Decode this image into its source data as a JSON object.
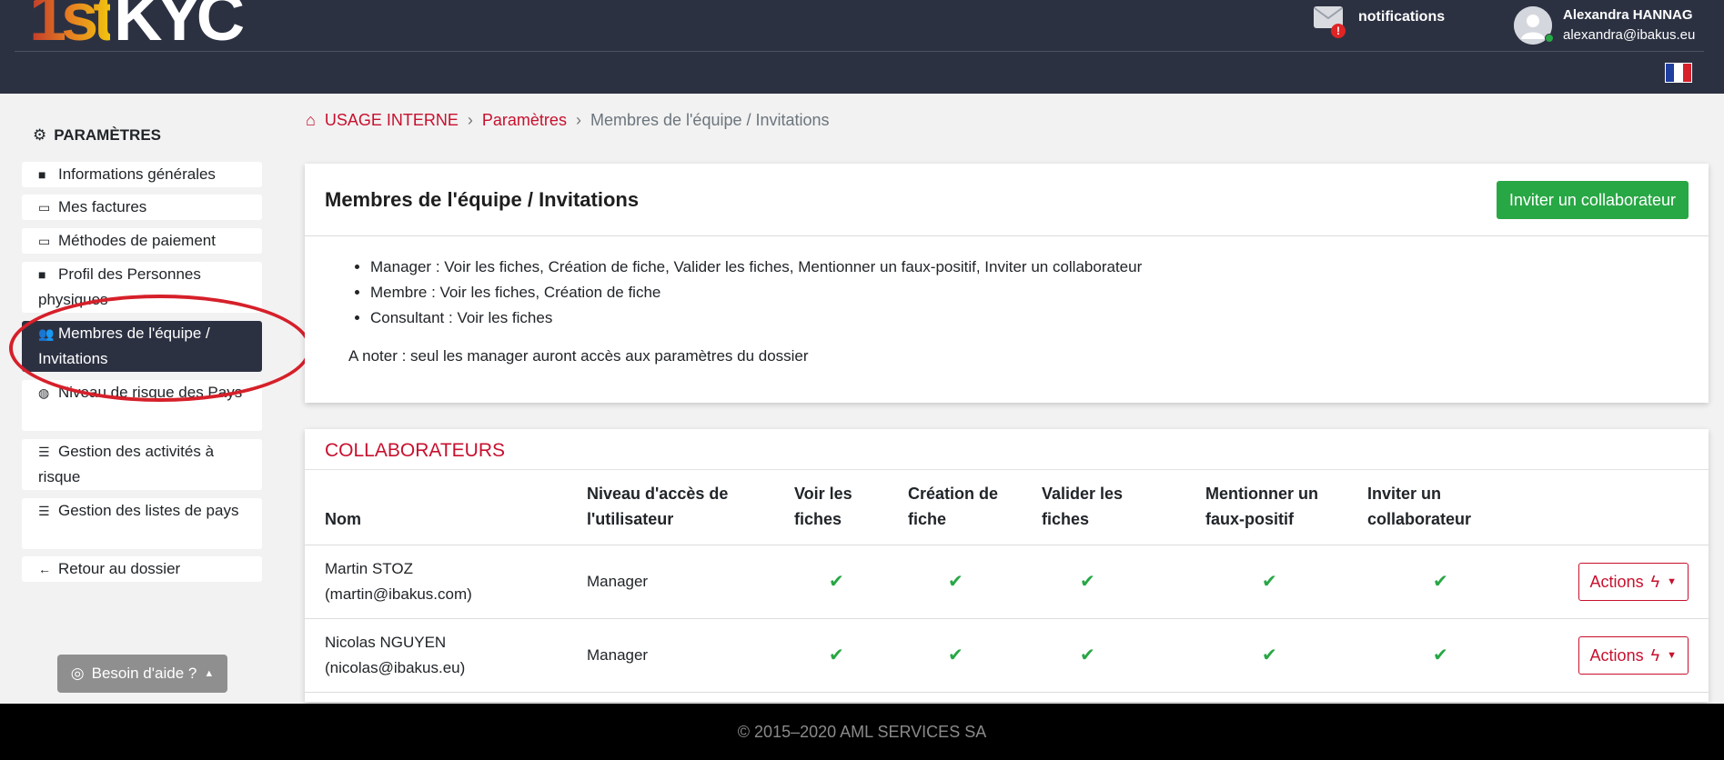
{
  "header": {
    "logo_a": "1st",
    "logo_b": "KYC",
    "notifications_label": "notifications",
    "notification_badge": "!",
    "user_name": "Alexandra HANNAG",
    "user_email": "alexandra@ibakus.eu"
  },
  "sidebar": {
    "title": "PARAMÈTRES",
    "items": [
      {
        "label": "Informations générales",
        "icon": "folder-icon"
      },
      {
        "label": "Mes factures",
        "icon": "credit-card-icon"
      },
      {
        "label": "Méthodes de paiement",
        "icon": "credit-card-icon"
      },
      {
        "label": "Profil des Personnes physiques",
        "icon": "folder-icon"
      },
      {
        "label": "Membres de l'équipe / Invitations",
        "icon": "users-icon",
        "active": true
      },
      {
        "label": "Niveau de risque des Pays",
        "icon": "globe-icon"
      },
      {
        "label": "Gestion des activités à risque",
        "icon": "list-icon"
      },
      {
        "label": "Gestion des listes de pays",
        "icon": "list-icon"
      },
      {
        "label": "Retour au dossier",
        "icon": "arrow-left-icon"
      }
    ],
    "help_label": "Besoin d'aide ?"
  },
  "breadcrumb": {
    "home": "USAGE INTERNE",
    "level2": "Paramètres",
    "current": "Membres de l'équipe / Invitations"
  },
  "panel": {
    "title": "Membres de l'équipe / Invitations",
    "invite_button": "Inviter un collaborateur",
    "permissions": [
      "Manager : Voir les fiches, Création de fiche, Valider les fiches, Mentionner un faux-positif, Inviter un collaborateur",
      "Membre : Voir les fiches, Création de fiche",
      "Consultant : Voir les fiches"
    ],
    "note": "A noter : seul les manager auront accès aux paramètres du dossier"
  },
  "collaborators": {
    "title": "COLLABORATEURS",
    "columns": [
      "Nom",
      "Niveau d'accès de l'utilisateur",
      "Voir les fiches",
      "Création de fiche",
      "Valider les fiches",
      "Mentionner un faux-positif",
      "Inviter un collaborateur"
    ],
    "rows": [
      {
        "name": "Martin STOZ",
        "email": "(martin@ibakus.com)",
        "level": "Manager",
        "actions": "Actions"
      },
      {
        "name": "Nicolas NGUYEN",
        "email": "(nicolas@ibakus.eu)",
        "level": "Manager",
        "actions": "Actions"
      }
    ]
  },
  "footer": {
    "text": "© 2015–2020 AML SERVICES SA"
  },
  "colors": {
    "header_bg": "#2c3142",
    "accent_red": "#c8102e",
    "green": "#28a745"
  }
}
